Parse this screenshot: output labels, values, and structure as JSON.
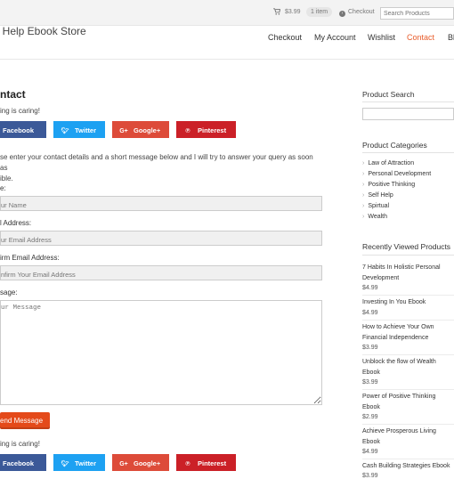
{
  "topbar": {
    "cart_price": "$3.99",
    "cart_items": "1 item",
    "checkout_label": "Checkout",
    "search_placeholder": "Search Products"
  },
  "header": {
    "site_title": "f Help Ebook Store",
    "nav": [
      "Checkout",
      "My Account",
      "Wishlist",
      "Contact",
      "Bl"
    ],
    "active_nav": "Contact"
  },
  "main": {
    "page_title": "ntact",
    "sharing_text": "ing is caring!",
    "share_buttons": {
      "facebook": "Facebook",
      "twitter": "Twitter",
      "googleplus": "Google+",
      "pinterest": "Pinterest"
    },
    "intro_line1": "se enter your contact details and a short message below and I will try to answer your query as soon as",
    "intro_line2": "ible.",
    "form": {
      "name_label": "e:",
      "name_placeholder": "ur Name",
      "email_label": "l Address:",
      "email_placeholder": "ur Email Address",
      "confirm_label": "irm Email Address:",
      "confirm_placeholder": "nfirm Your Email Address",
      "message_label": "sage:",
      "message_placeholder": "ur Message",
      "send_label": "end Message"
    }
  },
  "sidebar": {
    "search_title": "Product Search",
    "categories_title": "Product Categories",
    "categories": [
      "Law of Attraction",
      "Personal Development",
      "Positive Thinking",
      "Self Help",
      "Spirtual",
      "Wealth"
    ],
    "recent_title": "Recently Viewed Products",
    "recent": [
      {
        "line1": "7 Habits In Holistic Personal",
        "line2": "Development",
        "price": "$4.99"
      },
      {
        "line1": "Investing In You Ebook",
        "line2": "",
        "price": "$4.99"
      },
      {
        "line1": "How to Achieve Your Own",
        "line2": "Financial Independence",
        "price": "$3.99"
      },
      {
        "line1": "Unblock the flow of Wealth",
        "line2": "Ebook",
        "price": "$3.99"
      },
      {
        "line1": "Power of Positive Thinking",
        "line2": "Ebook",
        "price": "$2.99"
      },
      {
        "line1": "Achieve Prosperous Living",
        "line2": "Ebook",
        "price": "$4.99"
      },
      {
        "line1": "Cash Building Strategies Ebook",
        "line2": "",
        "price": "$3.99"
      }
    ]
  },
  "colors": {
    "accent": "#e85c2b",
    "facebook": "#3b5998",
    "twitter": "#1da1f2",
    "googleplus": "#dd4b39",
    "pinterest": "#cb2027",
    "send_button": "#e44a1a"
  }
}
